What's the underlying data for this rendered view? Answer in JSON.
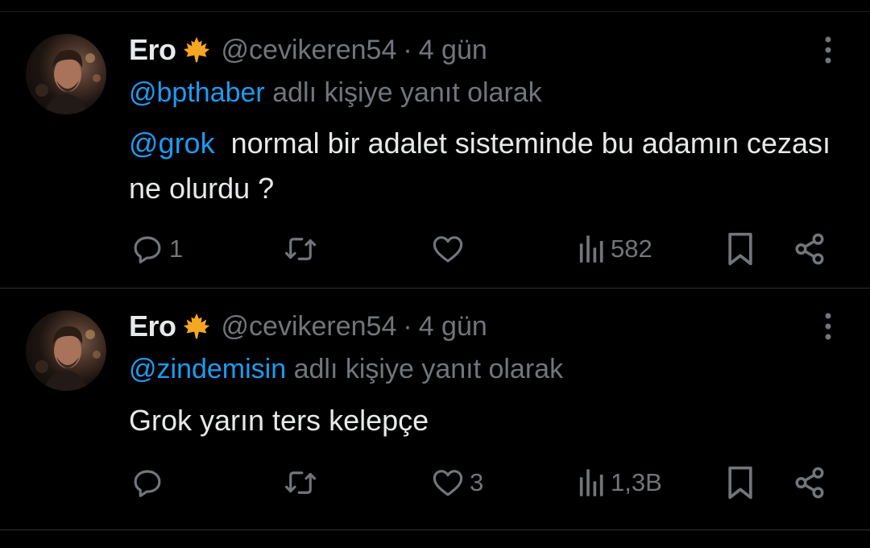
{
  "tweets": [
    {
      "author": {
        "name": "Ero",
        "badge_icon": "maple-leaf-icon",
        "handle": "@cevikeren54"
      },
      "separator": "·",
      "time": "4 gün",
      "reply_to": {
        "mention": "@bpthaber",
        "suffix": " adlı kişiye yanıt olarak"
      },
      "body": {
        "mention": "@grok",
        "text": "  normal bir adalet sisteminde bu adamın cezası ne olurdu ?"
      },
      "stats": {
        "replies": "1",
        "reposts": "",
        "likes": "",
        "views": "582"
      }
    },
    {
      "author": {
        "name": "Ero",
        "badge_icon": "maple-leaf-icon",
        "handle": "@cevikeren54"
      },
      "separator": "·",
      "time": "4 gün",
      "reply_to": {
        "mention": "@zindemisin",
        "suffix": " adlı kişiye yanıt olarak"
      },
      "body": {
        "mention": "",
        "text": "Grok yarın ters kelepçe"
      },
      "stats": {
        "replies": "",
        "reposts": "",
        "likes": "3",
        "views": "1,3B"
      }
    }
  ],
  "colors": {
    "background": "#000000",
    "text": "#e7e9ea",
    "secondary": "#71767b",
    "link": "#1d9bf0",
    "divider": "#2f3336",
    "leaf": "#f5a623"
  }
}
